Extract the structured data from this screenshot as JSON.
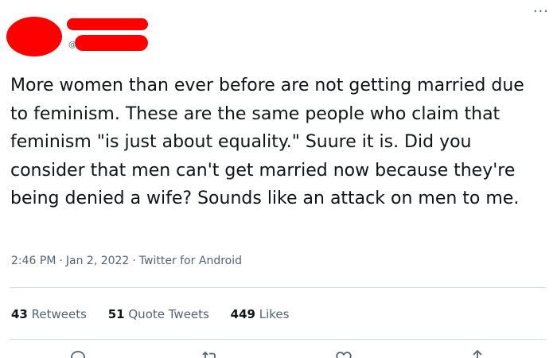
{
  "tweet": {
    "handle_prefix": "@",
    "body": "More women than ever before are not getting married due to feminism. These are the same people who claim that feminism \"is just about equality.\" Suure it is. Did you consider that men can't get married now because they're being denied a wife? Sounds like an attack on men to me.",
    "time": "2:46 PM",
    "date": "Jan 2, 2022",
    "source": "Twitter for Android",
    "separator": "·"
  },
  "stats": {
    "retweets_count": "43",
    "retweets_label": "Retweets",
    "quotes_count": "51",
    "quotes_label": "Quote Tweets",
    "likes_count": "449",
    "likes_label": "Likes"
  },
  "icons": {
    "more": "more-icon",
    "reply": "reply-icon",
    "retweet": "retweet-icon",
    "like": "like-icon",
    "share": "share-icon"
  },
  "colors": {
    "redaction": "#ff0000",
    "text": "#0f1419",
    "secondary": "#536471",
    "divider": "#cfd9de"
  }
}
